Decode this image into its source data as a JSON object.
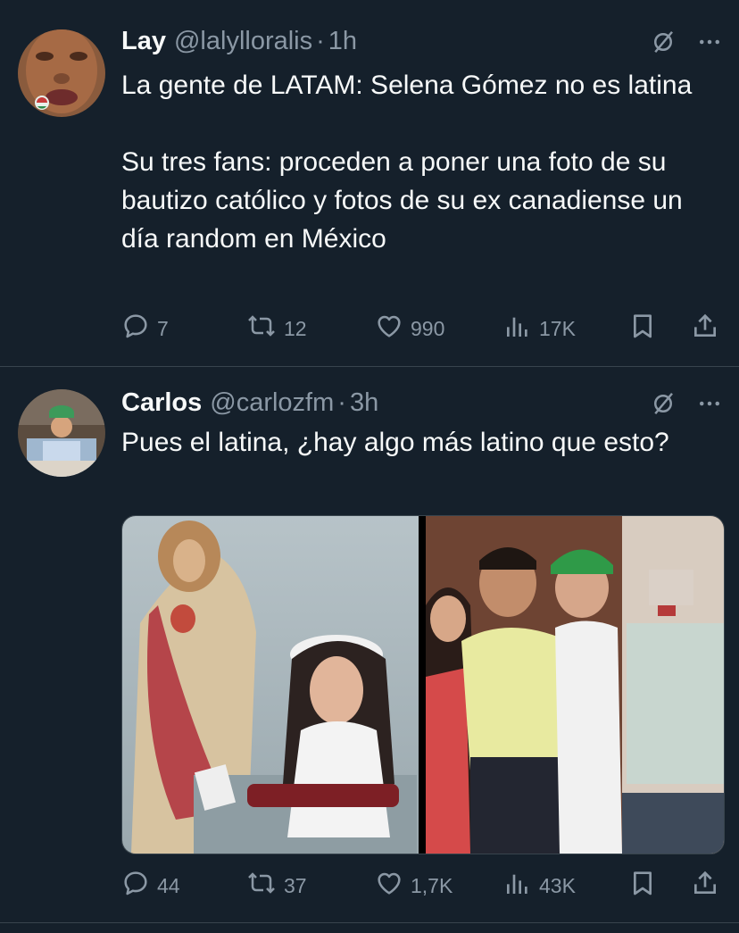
{
  "tweets": [
    {
      "author_name": "Lay",
      "handle": "@lalylloralis",
      "separator": "·",
      "time": "1h",
      "text": "La gente de LATAM: Selena Gómez no es latina\n\nSu tres fans: proceden a poner una foto de su bautizo católico y fotos de su ex canadiense un día random en México",
      "replies": "7",
      "retweets": "12",
      "likes": "990",
      "views": "17K",
      "icons": [
        "mute-icon",
        "more-icon",
        "reply-icon",
        "retweet-icon",
        "like-icon",
        "views-icon",
        "bookmark-icon",
        "share-icon"
      ]
    },
    {
      "author_name": "Carlos",
      "handle": "@carlozfm",
      "separator": "·",
      "time": "3h",
      "text": "Pues el latina, ¿hay algo más latino que esto?",
      "replies": "44",
      "retweets": "37",
      "likes": "1,7K",
      "views": "43K",
      "icons": [
        "mute-icon",
        "more-icon",
        "reply-icon",
        "retweet-icon",
        "like-icon",
        "views-icon",
        "bookmark-icon",
        "share-icon"
      ]
    }
  ],
  "colors": {
    "background": "#15202b",
    "text": "#f7f9f9",
    "secondary": "#8b98a5",
    "divider": "#38444d"
  }
}
